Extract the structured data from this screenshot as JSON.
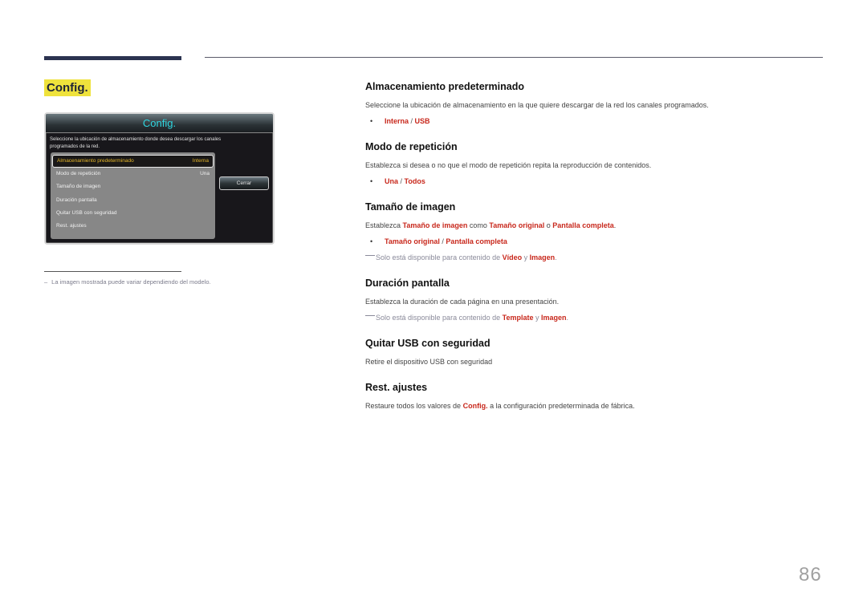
{
  "page": {
    "section_title": "Config.",
    "page_number": "86"
  },
  "dialog": {
    "title": "Config.",
    "description": "Seleccione la ubicación de almacenamiento donde desea descargar los canales programados de la red.",
    "items": [
      {
        "label": "Almacenamiento predeterminado",
        "value": "Interna",
        "selected": true
      },
      {
        "label": "Modo de repetición",
        "value": "Una"
      },
      {
        "label": "Tamaño de imagen",
        "value": ""
      },
      {
        "label": "Duración pantalla",
        "value": ""
      },
      {
        "label": "Quitar USB con seguridad",
        "value": ""
      },
      {
        "label": "Rest. ajustes",
        "value": ""
      }
    ],
    "close_label": "Cerrar"
  },
  "note": {
    "dash": "–",
    "text": "La imagen mostrada puede variar dependiendo del modelo."
  },
  "sections": {
    "storage": {
      "heading": "Almacenamiento predeterminado",
      "text": "Seleccione la ubicación de almacenamiento en la que quiere descargar de la red los canales programados.",
      "options": [
        "Interna",
        "USB"
      ]
    },
    "repeat": {
      "heading": "Modo de repetición",
      "text": "Establezca si desea o no que el modo de repetición repita la reproducción de contenidos.",
      "options": [
        "Una",
        "Todos"
      ]
    },
    "image_size": {
      "heading": "Tamaño de imagen",
      "text_pre": "Establezca ",
      "text_b1": "Tamaño de imagen",
      "text_mid1": " como ",
      "text_b2": "Tamaño original",
      "text_mid2": " o ",
      "text_b3": "Pantalla completa",
      "text_end": ".",
      "options": [
        "Tamaño original",
        "Pantalla completa"
      ],
      "footnote_pre": "Solo está disponible para contenido de ",
      "footnote_b1": "Vídeo",
      "footnote_mid": " y ",
      "footnote_b2": "Imagen",
      "footnote_end": "."
    },
    "duration": {
      "heading": "Duración pantalla",
      "text": "Establezca la duración de cada página en una presentación.",
      "footnote_pre": "Solo está disponible para contenido de ",
      "footnote_b1": "Template",
      "footnote_mid": " y ",
      "footnote_b2": "Imagen",
      "footnote_end": "."
    },
    "usb": {
      "heading": "Quitar USB con seguridad",
      "text": "Retire el dispositivo USB con seguridad"
    },
    "reset": {
      "heading": "Rest. ajustes",
      "text_pre": "Restaure todos los valores de ",
      "text_b": "Config.",
      "text_end": " a la configuración predeterminada de fábrica."
    }
  },
  "separators": {
    "bullet": "•",
    "slash": " / "
  }
}
